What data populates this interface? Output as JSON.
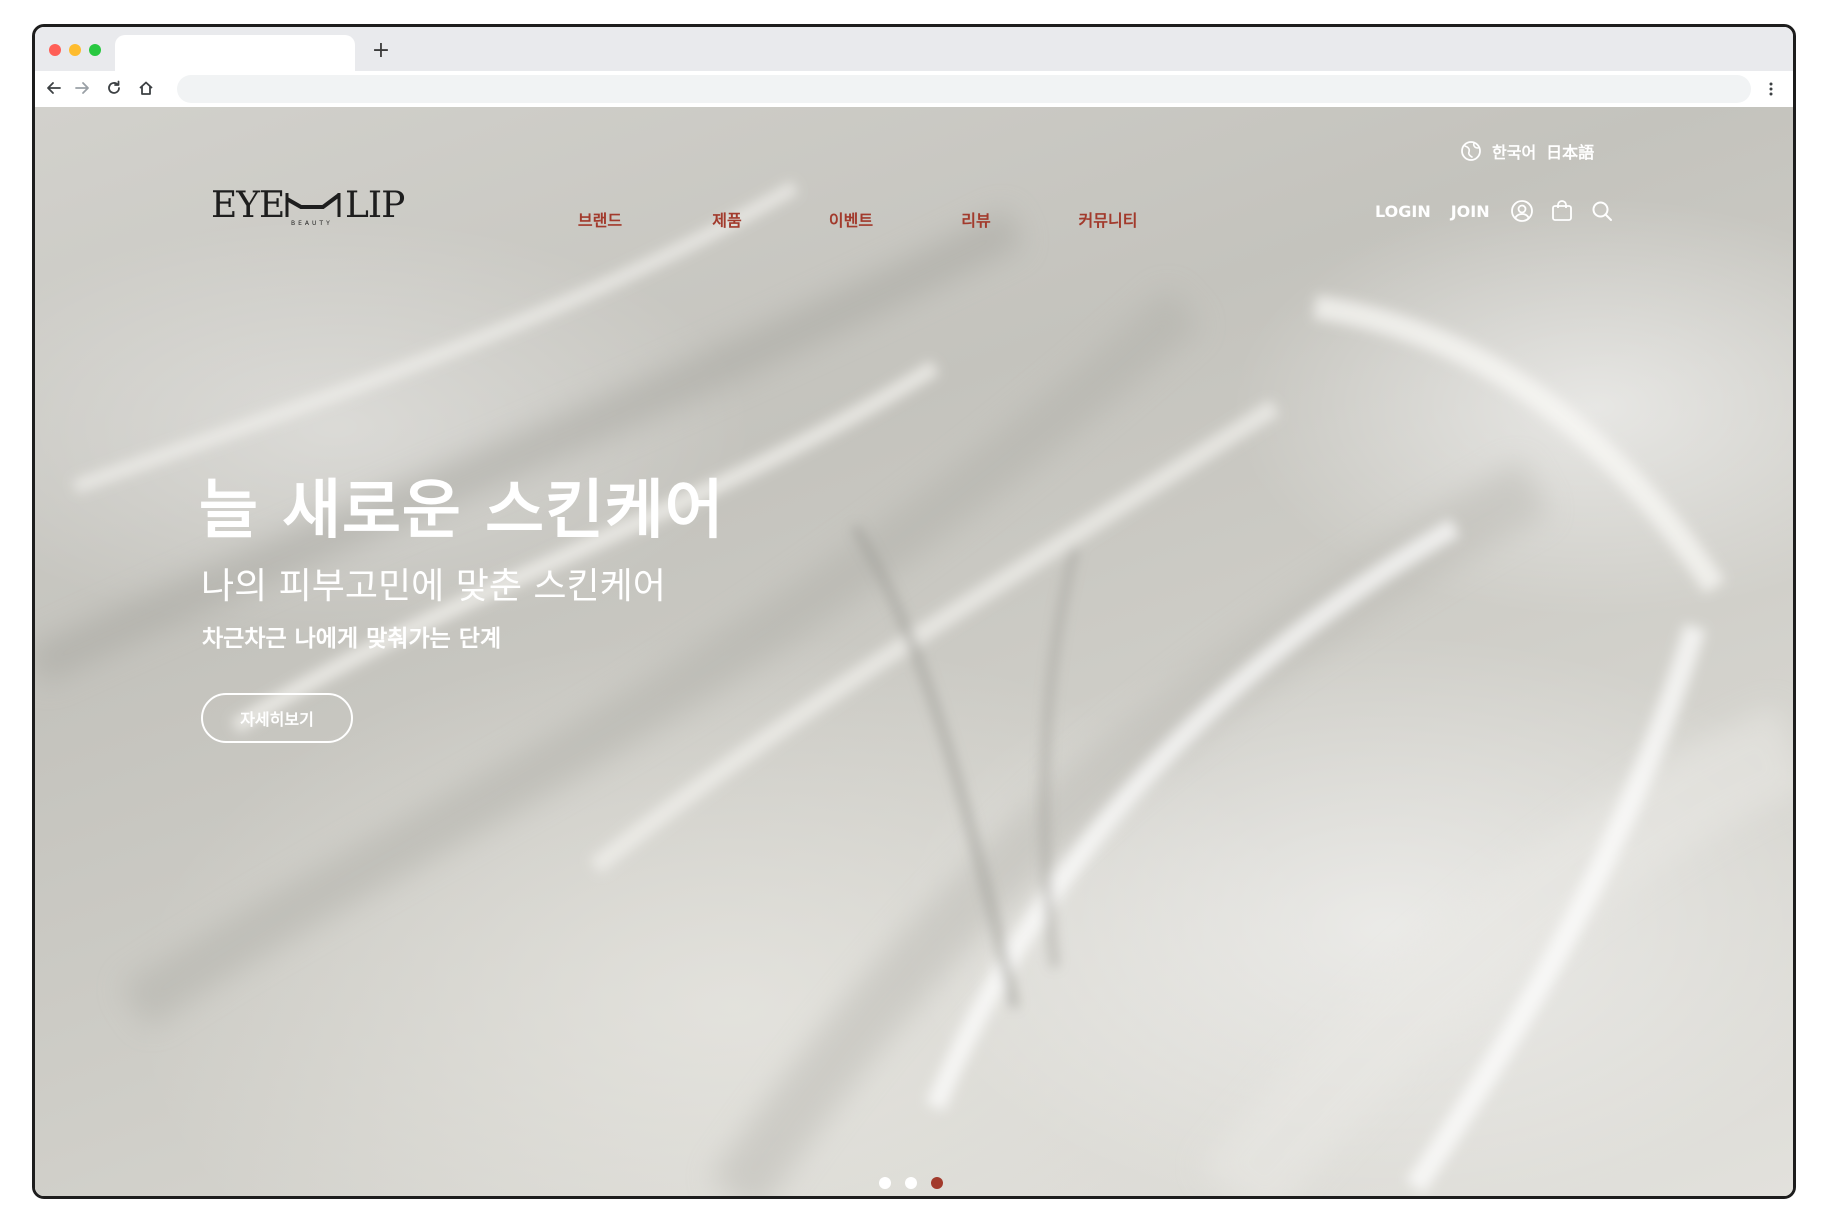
{
  "browser": {
    "new_tab_glyph": "+",
    "icons": [
      "back-arrow-icon",
      "forward-arrow-icon",
      "reload-icon",
      "home-icon",
      "kebab-menu-icon"
    ]
  },
  "header": {
    "language": {
      "icon": "globe-icon",
      "korean": "한국어",
      "japanese": "日本語"
    },
    "logo_text": "EYE N LIP",
    "logo_subtext": "BEAUTY",
    "nav": [
      "브랜드",
      "제품",
      "이벤트",
      "리뷰",
      "커뮤니티"
    ],
    "login": "LOGIN",
    "join": "JOIN",
    "icons": [
      "user-icon",
      "shopping-bag-icon",
      "search-icon"
    ]
  },
  "hero": {
    "title": "늘 새로운 스킨케어",
    "subtitle": "나의 피부고민에 맞춘 스킨케어",
    "description": "차근차근 나에게 맞춰가는 단계",
    "button": "자세히보기",
    "slides_total": 3,
    "active_slide": 3
  },
  "colors": {
    "accent": "#a23a2c",
    "text_on_hero": "#ffffff",
    "frame": "#1d1d1d"
  }
}
